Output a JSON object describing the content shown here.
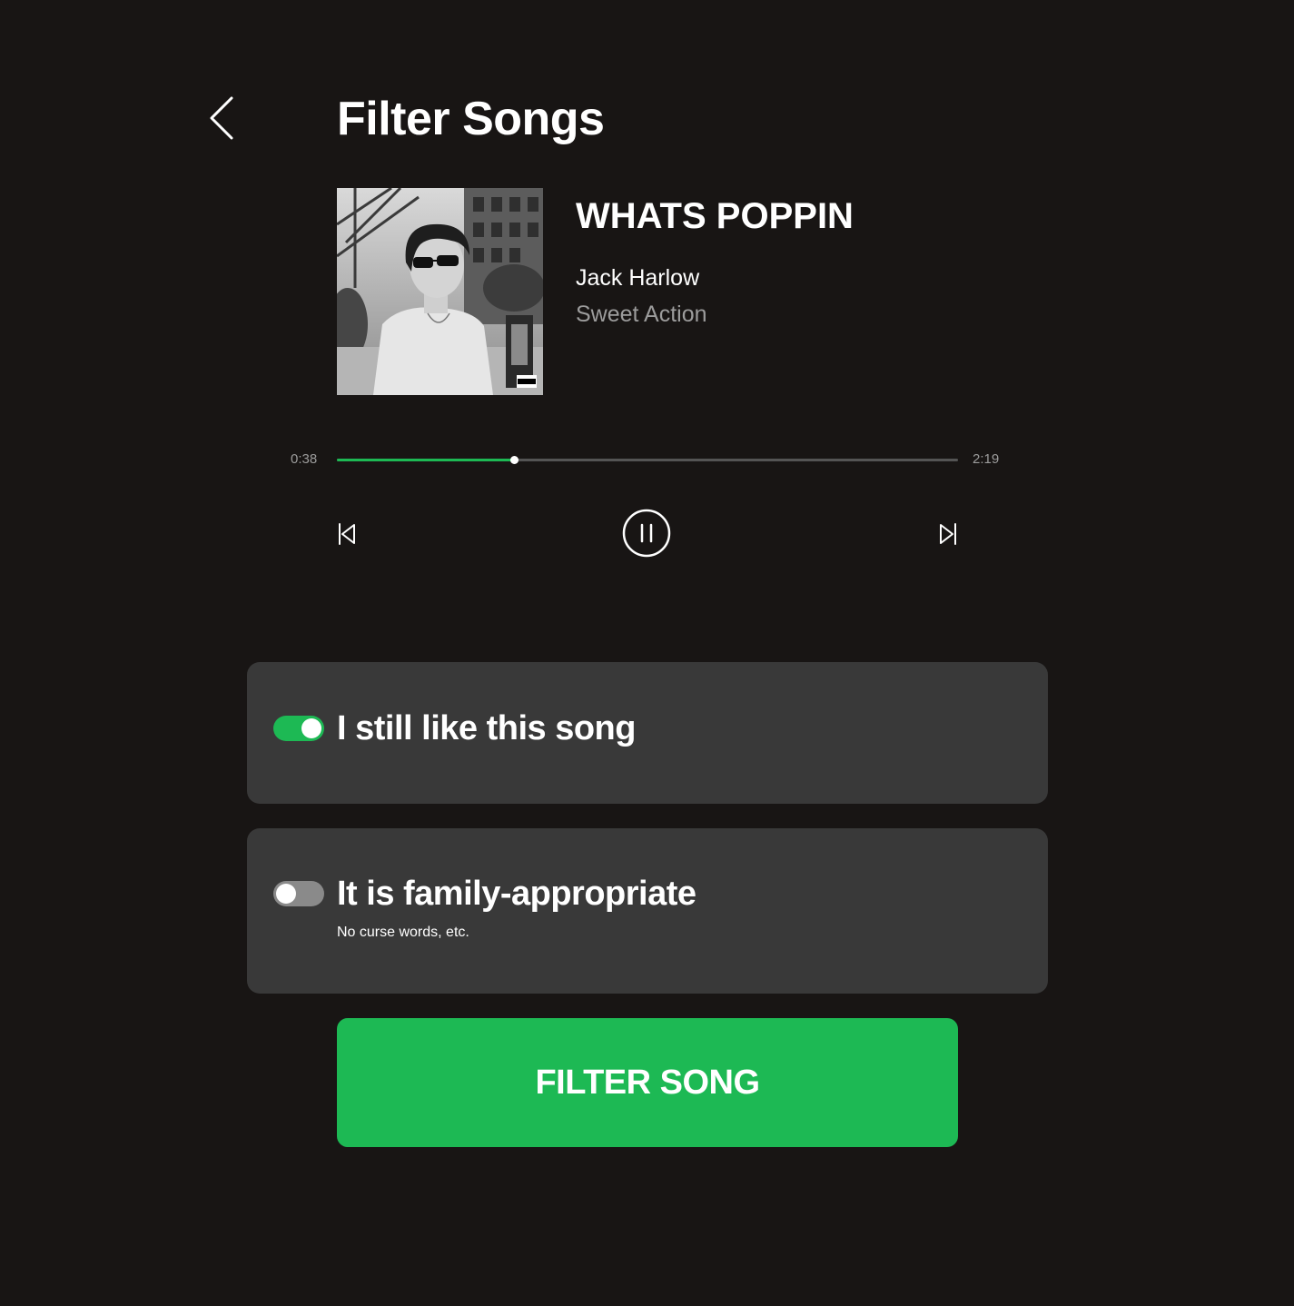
{
  "header": {
    "title": "Filter Songs",
    "back_icon": "chevron-left-icon"
  },
  "track": {
    "title": "WHATS POPPIN",
    "artist": "Jack Harlow",
    "album": "Sweet Action",
    "artwork": "album-cover-image"
  },
  "player": {
    "elapsed": "0:38",
    "duration": "2:19",
    "progress_fraction": 0.285,
    "state": "playing",
    "icons": {
      "previous": "skip-back-icon",
      "pause": "pause-circle-icon",
      "next": "skip-forward-icon"
    }
  },
  "filters": [
    {
      "label": "I still like this song",
      "sublabel": "",
      "enabled": true
    },
    {
      "label": "It is family-appropriate",
      "sublabel": "No curse words, etc.",
      "enabled": false
    }
  ],
  "action": {
    "label": "FILTER SONG"
  },
  "colors": {
    "background": "#181514",
    "card": "#393939",
    "accent": "#1db954",
    "muted_text": "#9c9c9c",
    "toggle_off": "#8a8a8a"
  }
}
